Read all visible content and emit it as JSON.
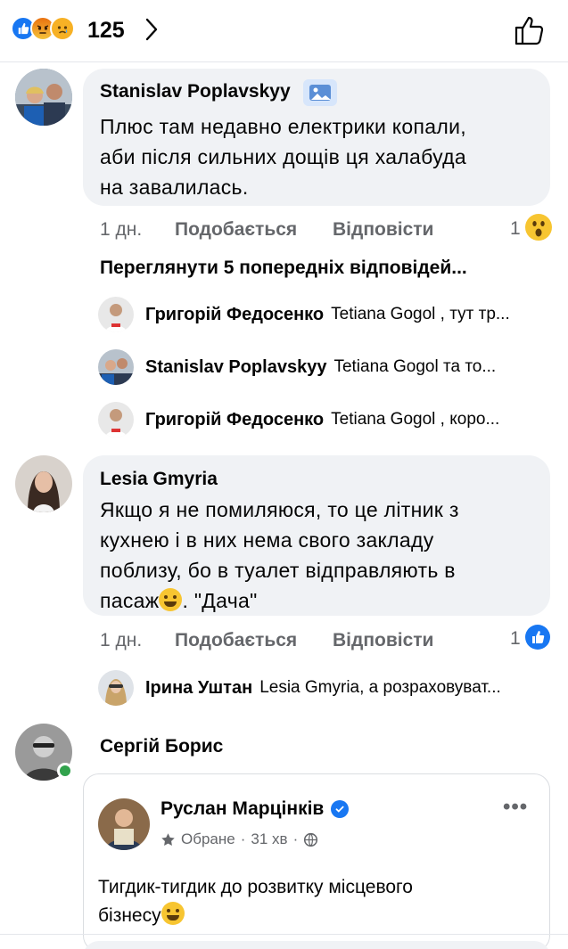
{
  "reactions_bar": {
    "count": "125",
    "icons": [
      "like-icon",
      "angry-icon",
      "sad-icon"
    ]
  },
  "comments": [
    {
      "author": "Stanislav Poplavskyy",
      "text_lines": [
        "Плюс там недавно електрики копали,",
        "аби після сильних дощів ця халабуда",
        "на завалилась."
      ],
      "time": "1 дн.",
      "like_label": "Подобається",
      "reply_label": "Відповісти",
      "reaction_count": "1",
      "reaction_icon": "wow-icon",
      "view_previous": "Переглянути 5 попередніх відповідей...",
      "replies": [
        {
          "name": "Григорій Федосенко",
          "snippet": "Tetiana Gogol , тут тр..."
        },
        {
          "name": "Stanislav Poplavskyy",
          "snippet": "Tetiana Gogol та то..."
        },
        {
          "name": "Григорій Федосенко",
          "snippet": "Tetiana Gogol , коро..."
        }
      ]
    },
    {
      "author": "Lesia Gmyria",
      "text_lines": [
        "Якщо я не помиляюся,  то це літник з",
        "кухнею і в них нема свого закладу",
        "поблизу, бо в туалет відправляють в",
        "пасаж",
        ". \"Дача\""
      ],
      "time": "1 дн.",
      "like_label": "Подобається",
      "reply_label": "Відповісти",
      "reaction_count": "1",
      "reaction_icon": "like-icon",
      "replies": [
        {
          "name": "Ірина Уштан",
          "snippet": "Lesia Gmyria, а розраховуват..."
        }
      ]
    },
    {
      "author": "Сергій Борис",
      "shared_post": {
        "author": "Руслан Марцінків",
        "meta_label": "Обране",
        "meta_time": "31 хв",
        "text_lines": [
          "Тигдик-тигдик до розвитку місцевого",
          "бізнесу"
        ]
      }
    }
  ],
  "colors": {
    "accent": "#1877f2",
    "bubble": "#f0f2f5",
    "muted_text": "#65676b",
    "online": "#31a24c"
  }
}
